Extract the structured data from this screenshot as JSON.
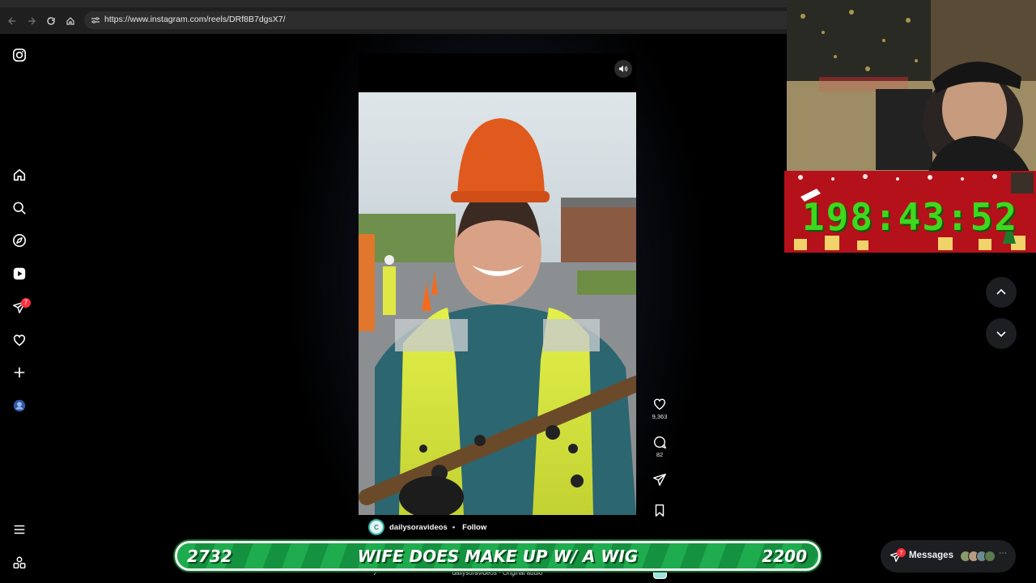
{
  "browser": {
    "url": "https://www.instagram.com/reels/DRf8B7dgsX7/"
  },
  "sidebar": {
    "items": [
      {
        "icon": "instagram-logo-icon"
      },
      {
        "icon": "home-icon"
      },
      {
        "icon": "search-icon"
      },
      {
        "icon": "explore-icon"
      },
      {
        "icon": "reels-icon"
      },
      {
        "icon": "messages-icon",
        "badge": "7"
      },
      {
        "icon": "heart-icon"
      },
      {
        "icon": "create-icon"
      },
      {
        "icon": "profile-icon"
      },
      {
        "icon": "menu-icon"
      },
      {
        "icon": "also-from-meta-icon"
      }
    ]
  },
  "reel": {
    "username": "dailysoravideos",
    "separator": "•",
    "follow_label": "Follow",
    "audio": "dailysoravideos · Original audio",
    "likes": "9,363",
    "comments": "82"
  },
  "messages": {
    "label": "Messages",
    "badge": "7"
  },
  "overlay": {
    "countdown": "198:43:52"
  },
  "banner": {
    "left_number": "2732",
    "title": "WIFE DOES MAKE UP W/ A WIG",
    "right_number": "2200"
  },
  "colors": {
    "background": "#000000",
    "notification_badge": "#ff3040",
    "banner_green": "#1eac4e",
    "countdown_red": "#b4111b",
    "countdown_digits": "#3ed81e"
  }
}
